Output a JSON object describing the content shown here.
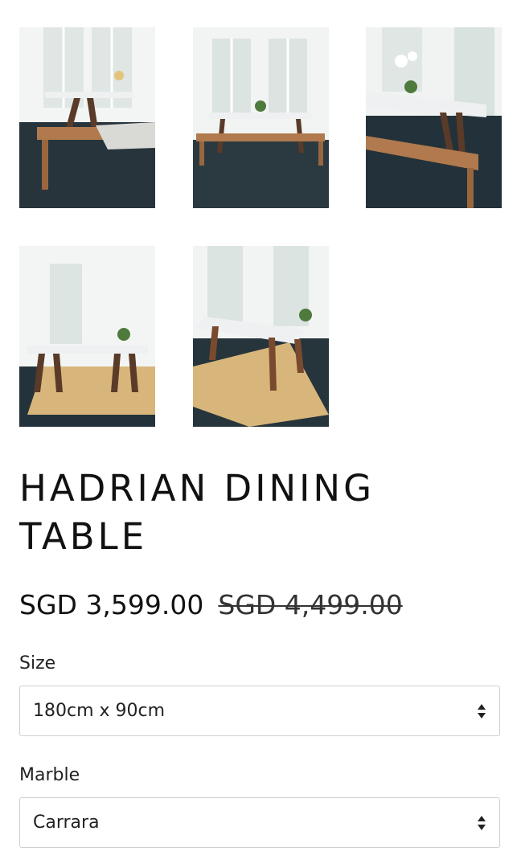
{
  "gallery": {
    "images": [
      {
        "alt": "Dining table with bench, front view"
      },
      {
        "alt": "Dining table set with chairs in bright room"
      },
      {
        "alt": "Dining table with orchid and bench, angled view"
      },
      {
        "alt": "Dining table on jute rug, wide view"
      },
      {
        "alt": "Dining table on jute rug, angled view"
      }
    ]
  },
  "product": {
    "title": "HADRIAN DINING TABLE",
    "price": "SGD 3,599.00",
    "compare_price": "SGD 4,499.00"
  },
  "options": {
    "size": {
      "label": "Size",
      "selected": "180cm x 90cm"
    },
    "marble": {
      "label": "Marble",
      "selected": "Carrara"
    }
  },
  "colors": {
    "floor": "#27343c",
    "wood": "#b07a4e",
    "marble": "#eef0f1",
    "rug": "#d8b57a"
  }
}
